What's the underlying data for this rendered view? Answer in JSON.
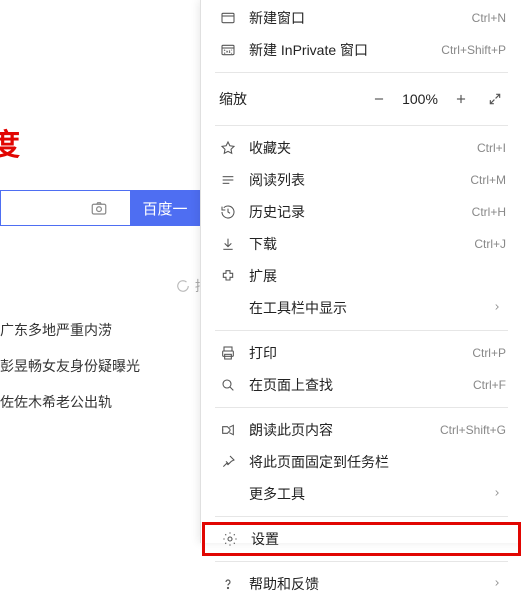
{
  "logo_partial": "度",
  "search": {
    "button_partial": "百度一"
  },
  "loading_text": "拼",
  "news": [
    "广东多地严重内涝",
    "彭昱畅女友身份疑曝光",
    "佐佐木希老公出轨"
  ],
  "menu": {
    "new_window": {
      "label": "新建窗口",
      "shortcut": "Ctrl+N"
    },
    "new_inprivate": {
      "label": "新建 InPrivate 窗口",
      "shortcut": "Ctrl+Shift+P"
    },
    "zoom": {
      "label": "缩放",
      "value": "100%"
    },
    "favorites": {
      "label": "收藏夹",
      "shortcut": "Ctrl+I"
    },
    "reading_list": {
      "label": "阅读列表",
      "shortcut": "Ctrl+M"
    },
    "history": {
      "label": "历史记录",
      "shortcut": "Ctrl+H"
    },
    "downloads": {
      "label": "下载",
      "shortcut": "Ctrl+J"
    },
    "extensions": {
      "label": "扩展"
    },
    "show_in_toolbar": {
      "label": "在工具栏中显示"
    },
    "print": {
      "label": "打印",
      "shortcut": "Ctrl+P"
    },
    "find": {
      "label": "在页面上查找",
      "shortcut": "Ctrl+F"
    },
    "read_aloud": {
      "label": "朗读此页内容",
      "shortcut": "Ctrl+Shift+G"
    },
    "pin_taskbar": {
      "label": "将此页面固定到任务栏"
    },
    "more_tools": {
      "label": "更多工具"
    },
    "settings": {
      "label": "设置"
    },
    "help": {
      "label": "帮助和反馈"
    }
  }
}
